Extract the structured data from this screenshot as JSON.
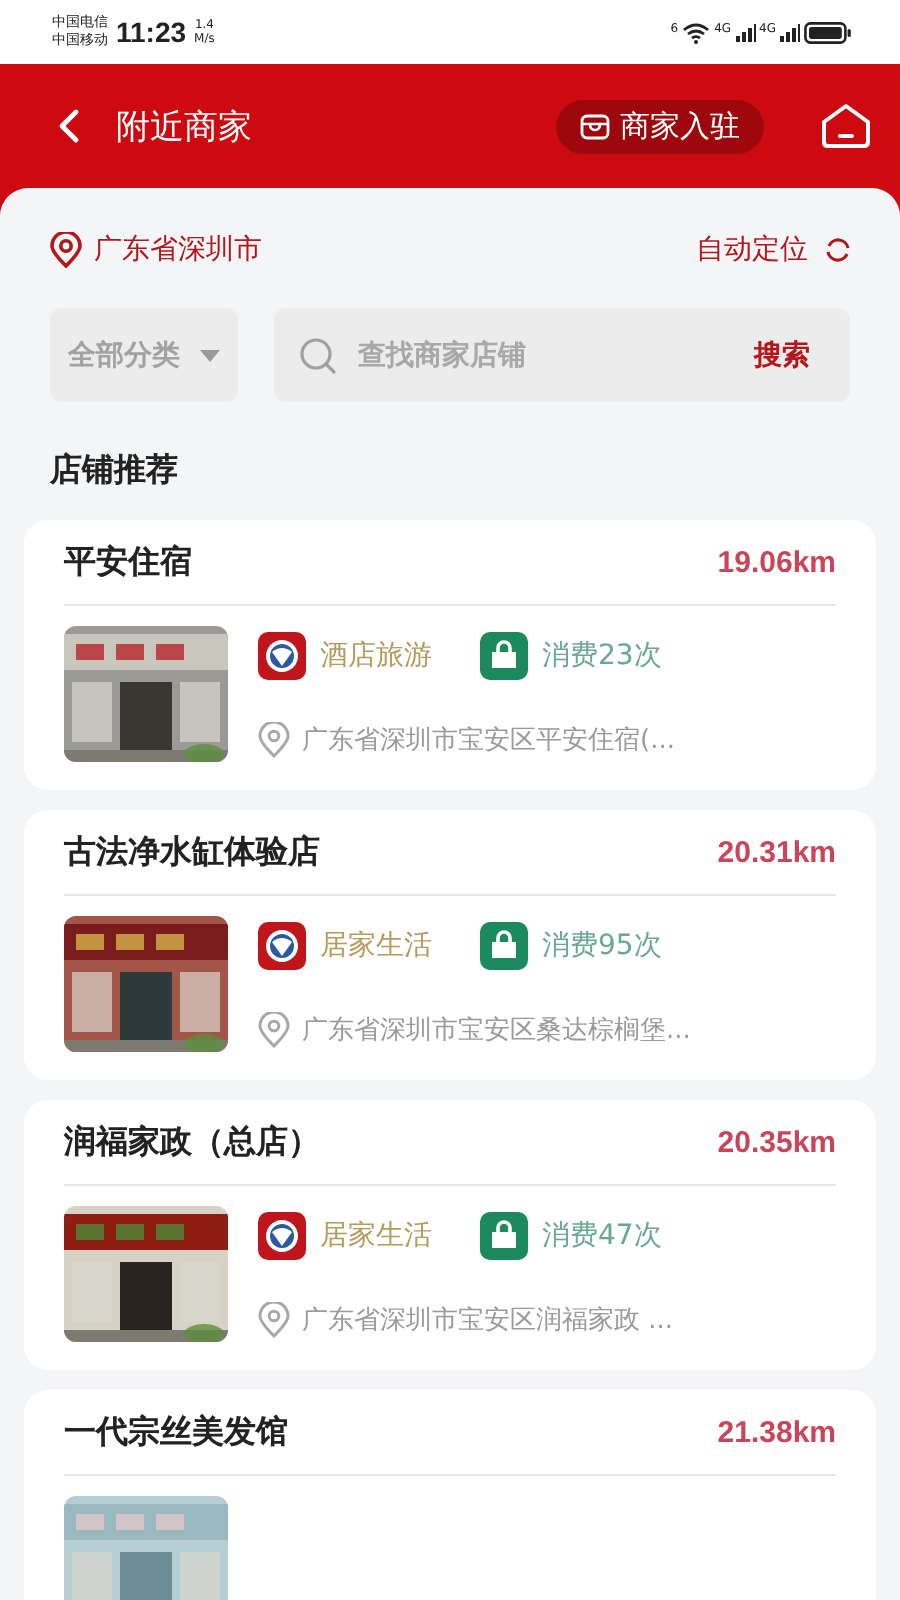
{
  "status_bar": {
    "carrier_1": "中国电信",
    "carrier_2": "中国移动",
    "time": "11:23",
    "speed_value": "1.4",
    "speed_unit": "M/s",
    "wifi_badge": "6",
    "network_1": "4G",
    "network_2": "4G"
  },
  "header": {
    "title": "附近商家",
    "join_button": "商家入驻"
  },
  "location": {
    "city": "广东省深圳市",
    "auto_locate": "自动定位"
  },
  "filters": {
    "category": "全部分类",
    "search_placeholder": "查找商家店铺",
    "search_button": "搜索"
  },
  "section_title": "店铺推荐",
  "shops": [
    {
      "name": "平安住宿",
      "distance": "19.06km",
      "category": "酒店旅游",
      "visits": "消费23次",
      "address": "广东省深圳市宝安区平安住宿(..."
    },
    {
      "name": "古法净水缸体验店",
      "distance": "20.31km",
      "category": "居家生活",
      "visits": "消费95次",
      "address": "广东省深圳市宝安区桑达棕榈堡..."
    },
    {
      "name": "润福家政（总店）",
      "distance": "20.35km",
      "category": "居家生活",
      "visits": "消费47次",
      "address": "广东省深圳市宝安区润福家政 ..."
    },
    {
      "name": "一代宗丝美发馆",
      "distance": "21.38km"
    }
  ]
}
